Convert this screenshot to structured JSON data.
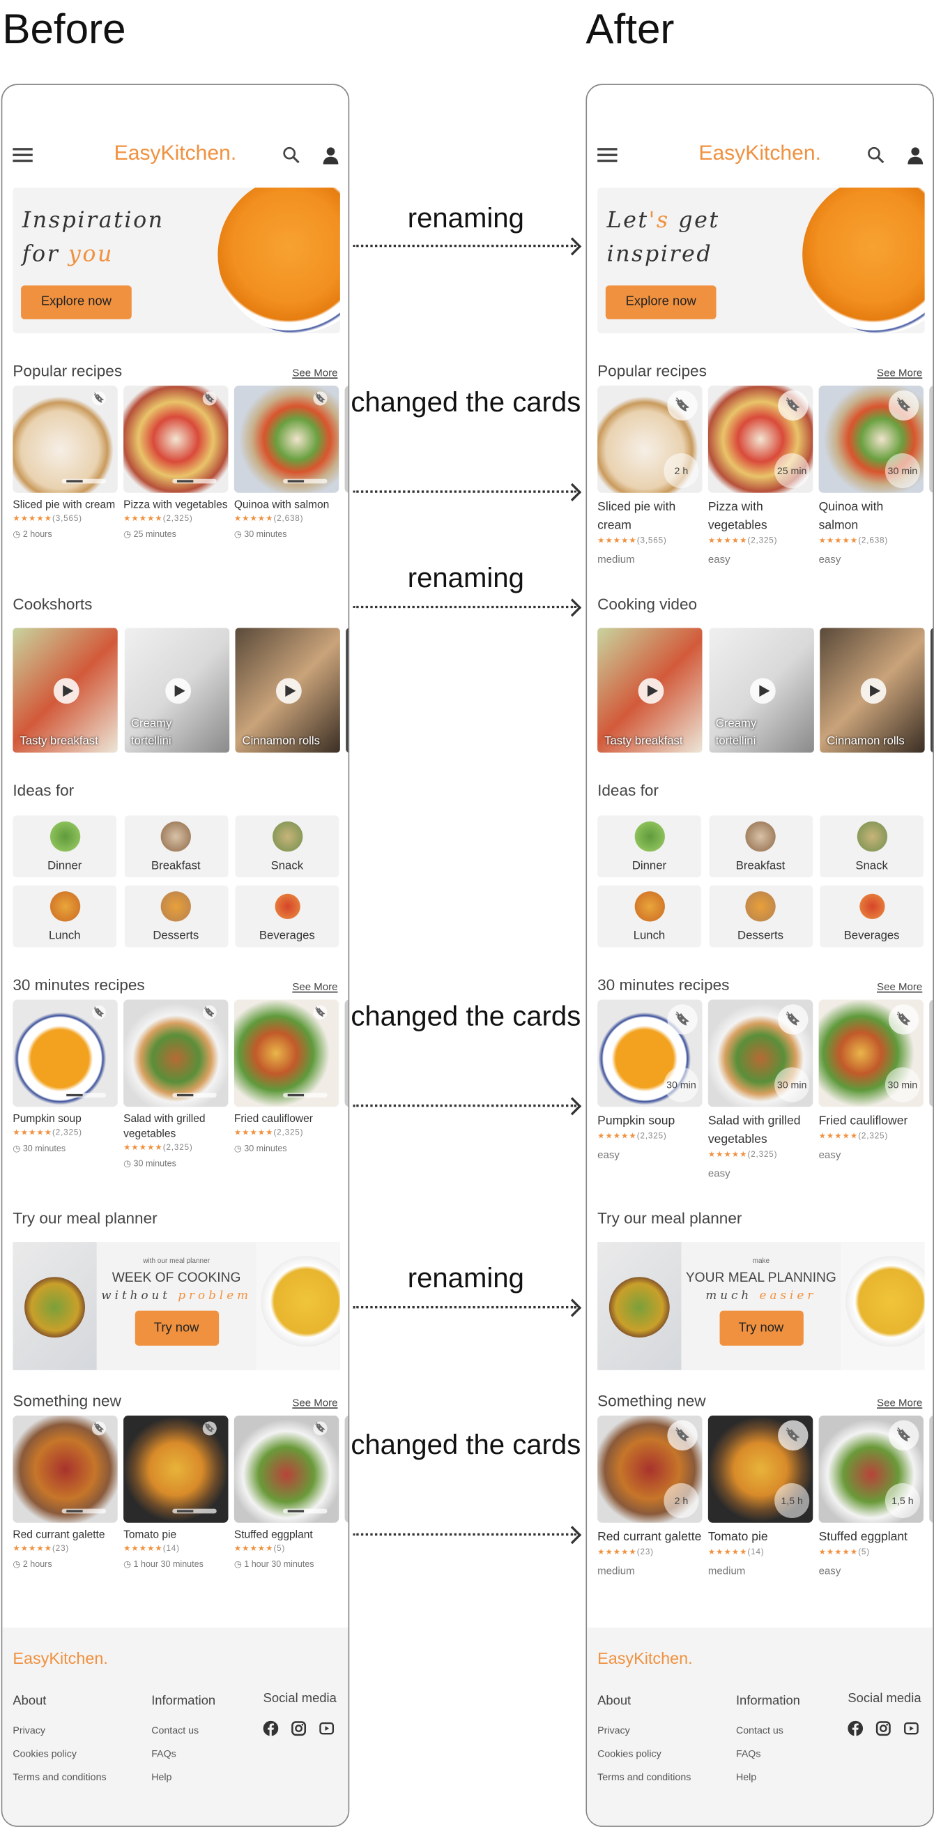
{
  "columns": {
    "before_title": "Before",
    "after_title": "After"
  },
  "annotations": [
    "renaming",
    "changed the cards",
    "renaming",
    "changed the cards",
    "renaming",
    "changed the cards"
  ],
  "colors": {
    "accent": "#f0913f",
    "text": "#444444",
    "panel": "#f3f3f3"
  },
  "phones": [
    {
      "variant": "before",
      "logo": {
        "part1": "Easy",
        "part2": "Kitchen."
      },
      "header_icons": [
        "menu-icon",
        "search-icon",
        "user-icon"
      ],
      "hero": {
        "line1": "Inspiration",
        "line2a": "for ",
        "line2b": "you",
        "button": "Explore now"
      },
      "popular": {
        "title": "Popular recipes",
        "see_more": "See More",
        "cards": [
          {
            "title": "Sliced pie with cream",
            "stars": "★★★★★",
            "count": "(3,565)",
            "meta": "2 hours"
          },
          {
            "title": "Pizza with vegetables",
            "stars": "★★★★★",
            "count": "(2,325)",
            "meta": "25 minutes"
          },
          {
            "title": "Quinoa with salmon",
            "stars": "★★★★★",
            "count": "(2,638)",
            "meta": "30 minutes"
          }
        ]
      },
      "videos": {
        "title": "Cookshorts",
        "items": [
          "Tasty breakfast",
          "Creamy tortellini",
          "Cinnamon rolls"
        ]
      },
      "ideas": {
        "title": "Ideas for",
        "items": [
          "Dinner",
          "Breakfast",
          "Snack",
          "Lunch",
          "Desserts",
          "Beverages"
        ]
      },
      "thirty": {
        "title": "30 minutes recipes",
        "see_more": "See More",
        "cards": [
          {
            "title": "Pumpkin soup",
            "stars": "★★★★★",
            "count": "(2,325)",
            "meta": "30 minutes"
          },
          {
            "title": "Salad with grilled vegetables",
            "stars": "★★★★★",
            "count": "(2,325)",
            "meta": "30 minutes"
          },
          {
            "title": "Fried cauliflower",
            "stars": "★★★★★",
            "count": "(2,325)",
            "meta": "30 minutes"
          }
        ]
      },
      "planner": {
        "title": "Try our meal planner",
        "small": "with our meal planner",
        "big": "WEEK OF COOKING",
        "script_a": "without ",
        "script_b": "problem",
        "button": "Try now"
      },
      "newest": {
        "title": "Something new",
        "see_more": "See More",
        "cards": [
          {
            "title": "Red currant galette",
            "stars": "★★★★★",
            "count": "(23)",
            "meta": "2 hours"
          },
          {
            "title": "Tomato pie",
            "stars": "★★★★★",
            "count": "(14)",
            "meta": "1 hour 30 minutes"
          },
          {
            "title": "Stuffed eggplant",
            "stars": "★★★★★",
            "count": "(5)",
            "meta": "1 hour 30 minutes"
          }
        ]
      },
      "footer": {
        "logo_part1": "Easy",
        "logo_part2": "Kitchen.",
        "about": "About",
        "about_links": [
          "Privacy",
          "Cookies policy",
          "Terms and conditions"
        ],
        "information": "Information",
        "info_links": [
          "Contact us",
          "FAQs",
          "Help"
        ],
        "social": "Social media",
        "social_icons": [
          "facebook-icon",
          "instagram-icon",
          "youtube-icon"
        ]
      }
    },
    {
      "variant": "after",
      "logo": {
        "part1": "Easy",
        "part2": "Kitchen."
      },
      "header_icons": [
        "menu-icon",
        "search-icon",
        "user-icon"
      ],
      "hero": {
        "line1a": "Let",
        "line1b": "'s",
        "line1c": " get",
        "line2": "inspired",
        "button": "Explore now"
      },
      "popular": {
        "title": "Popular recipes",
        "see_more": "See More",
        "cards": [
          {
            "title": "Sliced pie with cream",
            "stars": "★★★★★",
            "count": "(3,565)",
            "meta": "medium",
            "badge": "2 h"
          },
          {
            "title": "Pizza with vegetables",
            "stars": "★★★★★",
            "count": "(2,325)",
            "meta": "easy",
            "badge": "25 min"
          },
          {
            "title": "Quinoa with salmon",
            "stars": "★★★★★",
            "count": "(2,638)",
            "meta": "easy",
            "badge": "30 min"
          }
        ]
      },
      "videos": {
        "title": "Cooking video",
        "items": [
          "Tasty breakfast",
          "Creamy tortellini",
          "Cinnamon rolls"
        ]
      },
      "ideas": {
        "title": "Ideas for",
        "items": [
          "Dinner",
          "Breakfast",
          "Snack",
          "Lunch",
          "Desserts",
          "Beverages"
        ]
      },
      "thirty": {
        "title": "30 minutes recipes",
        "see_more": "See More",
        "cards": [
          {
            "title": "Pumpkin soup",
            "stars": "★★★★★",
            "count": "(2,325)",
            "meta": "easy",
            "badge": "30 min"
          },
          {
            "title": "Salad with grilled vegetables",
            "stars": "★★★★★",
            "count": "(2,325)",
            "meta": "easy",
            "badge": "30 min"
          },
          {
            "title": "Fried cauliflower",
            "stars": "★★★★★",
            "count": "(2,325)",
            "meta": "easy",
            "badge": "30 min"
          }
        ]
      },
      "planner": {
        "title": "Try our meal planner",
        "small": "make",
        "big": "YOUR MEAL PLANNING",
        "script_a": "much ",
        "script_b": "easier",
        "button": "Try now"
      },
      "newest": {
        "title": "Something new",
        "see_more": "See More",
        "cards": [
          {
            "title": "Red currant galette",
            "stars": "★★★★★",
            "count": "(23)",
            "meta": "medium",
            "badge": "2 h"
          },
          {
            "title": "Tomato pie",
            "stars": "★★★★★",
            "count": "(14)",
            "meta": "medium",
            "badge": "1,5 h"
          },
          {
            "title": "Stuffed eggplant",
            "stars": "★★★★★",
            "count": "(5)",
            "meta": "easy",
            "badge": "1,5 h"
          }
        ]
      },
      "footer": {
        "logo_part1": "Easy",
        "logo_part2": "Kitchen.",
        "about": "About",
        "about_links": [
          "Privacy",
          "Cookies policy",
          "Terms and conditions"
        ],
        "information": "Information",
        "info_links": [
          "Contact us",
          "FAQs",
          "Help"
        ],
        "social": "Social media",
        "social_icons": [
          "facebook-icon",
          "instagram-icon",
          "youtube-icon"
        ]
      }
    }
  ]
}
